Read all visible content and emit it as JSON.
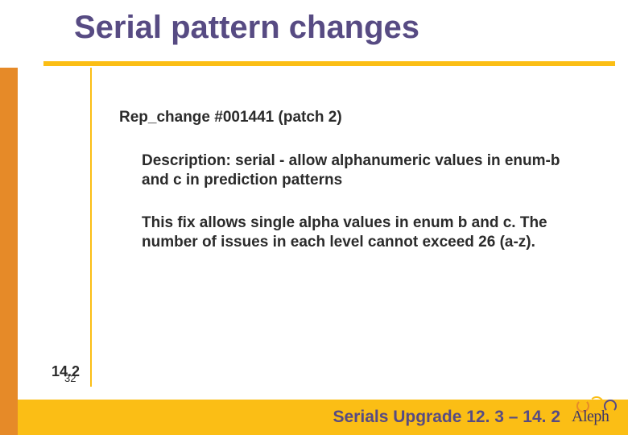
{
  "title": "Serial pattern changes",
  "body": {
    "heading": "Rep_change #001441 (patch 2)",
    "description": "Description: serial - allow alphanumeric values in enum-b and c in prediction patterns",
    "detail": "This fix allows single alpha values in enum b and c.  The number of issues in each level cannot exceed 26 (a-z)."
  },
  "version_tag": "14.2",
  "page_number": "32",
  "footer": "Serials Upgrade 12. 3 – 14. 2",
  "logo_text": "Aleph"
}
